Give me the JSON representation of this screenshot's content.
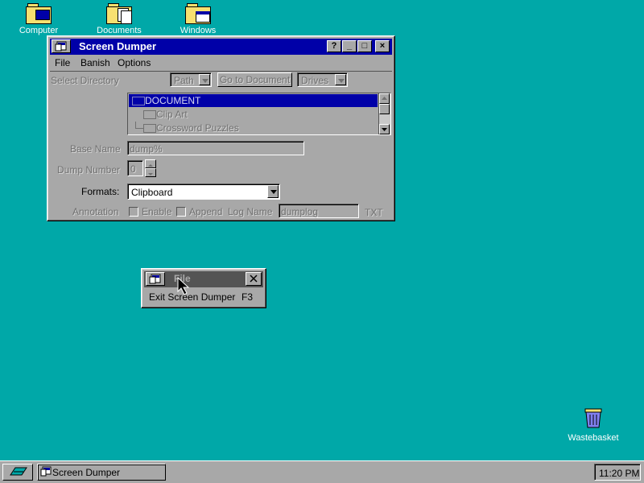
{
  "desktop": {
    "icons": [
      {
        "label": "Computer",
        "icon": "computer-icon"
      },
      {
        "label": "Documents",
        "icon": "documents-folder-icon"
      },
      {
        "label": "Windows",
        "icon": "windows-folder-icon"
      }
    ],
    "wastebasket": {
      "label": "Wastebasket",
      "icon": "wastebasket-icon"
    }
  },
  "window": {
    "title": "Screen Dumper",
    "controls": {
      "help": "?",
      "minimize": "_",
      "maximize": "□",
      "close": "×"
    },
    "menu": [
      {
        "label": "File"
      },
      {
        "label": "Banish"
      },
      {
        "label": "Options"
      }
    ],
    "select_directory": {
      "label": "Select Directory",
      "path_button": "Path",
      "goto_button": "Go to Document",
      "drives_button": "Drives"
    },
    "tree": [
      {
        "label": "DOCUMENT",
        "selected": true
      },
      {
        "label": "Clip Art",
        "selected": false
      },
      {
        "label": "Crossword Puzzles",
        "selected": false
      }
    ],
    "base_name": {
      "label": "Base Name",
      "value": "dump%"
    },
    "dump_number": {
      "label": "Dump Number",
      "value": "0"
    },
    "formats": {
      "label": "Formats:",
      "value": "Clipboard"
    },
    "annotation": {
      "label": "Annotation",
      "enable": "Enable",
      "append": "Append",
      "log_name_label": "Log Name",
      "log_name_value": "dumplog",
      "extension": "TXT"
    }
  },
  "file_menu_popup": {
    "title": "File",
    "items": [
      {
        "label": "Exit Screen Dumper",
        "shortcut": "F3"
      }
    ]
  },
  "taskbar": {
    "task_label": "Screen Dumper",
    "clock": "11:20 PM"
  },
  "colors": {
    "desktop": "#00a8a8",
    "titlebar_active": "#0000a8",
    "face": "#a8a8a8"
  }
}
